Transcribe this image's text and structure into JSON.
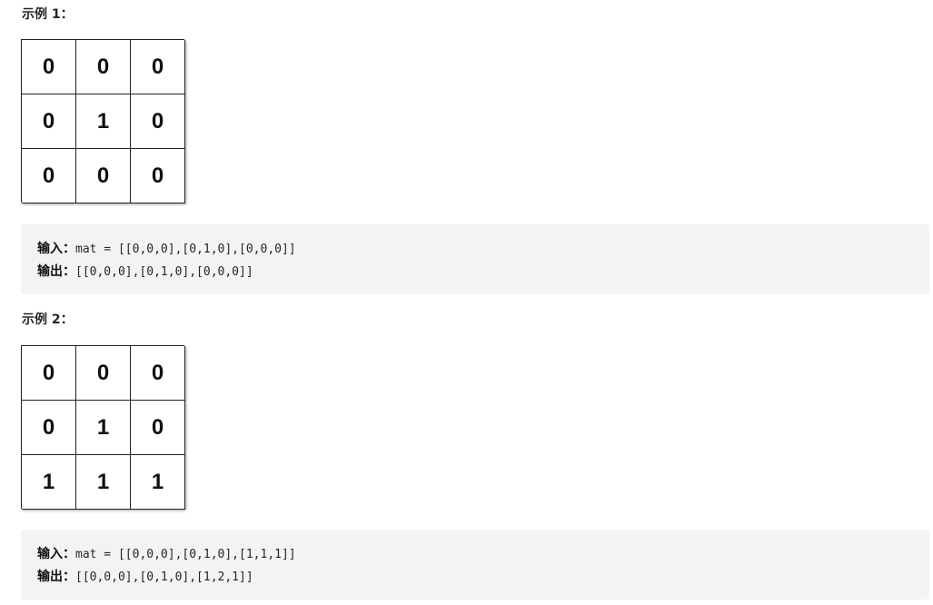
{
  "examples": [
    {
      "title": "示例 1：",
      "grid": [
        [
          "0",
          "0",
          "0"
        ],
        [
          "0",
          "1",
          "0"
        ],
        [
          "0",
          "0",
          "0"
        ]
      ],
      "input_label": "输入：",
      "input_value": "mat = [[0,0,0],[0,1,0],[0,0,0]]",
      "output_label": "输出：",
      "output_value": "[[0,0,0],[0,1,0],[0,0,0]]"
    },
    {
      "title": "示例 2：",
      "grid": [
        [
          "0",
          "0",
          "0"
        ],
        [
          "0",
          "1",
          "0"
        ],
        [
          "1",
          "1",
          "1"
        ]
      ],
      "input_label": "输入：",
      "input_value": "mat = [[0,0,0],[0,1,0],[1,1,1]]",
      "output_label": "输出：",
      "output_value": "[[0,0,0],[0,1,0],[1,2,1]]"
    }
  ]
}
